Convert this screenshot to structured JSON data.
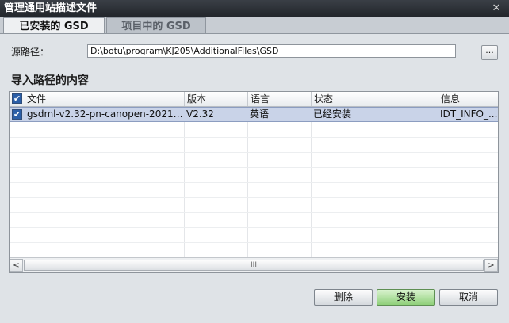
{
  "window": {
    "title": "管理通用站描述文件",
    "close_glyph": "✕"
  },
  "tabs": [
    {
      "label": "已安装的 GSD",
      "active": true
    },
    {
      "label": "项目中的 GSD",
      "active": false
    }
  ],
  "source_path": {
    "label": "源路径：",
    "value": "D:\\botu\\program\\KJ205\\AdditionalFiles\\GSD",
    "browse_label": "..."
  },
  "content_section": {
    "title": "导入路径的内容"
  },
  "table": {
    "header_checked": true,
    "columns": [
      "文件",
      "版本",
      "语言",
      "状态",
      "信息"
    ],
    "rows": [
      {
        "checked": true,
        "file": "gsdml-v2.32-pn-canopen-202111...",
        "version": "V2.32",
        "language": "英语",
        "status": "已经安装",
        "info": "IDT_INFO_..."
      }
    ]
  },
  "scrollbar": {
    "left_arrow": "<",
    "right_arrow": ">",
    "thumb_grip": "III"
  },
  "buttons": {
    "delete": "删除",
    "install": "安装",
    "cancel": "取消"
  },
  "colors": {
    "selection": "#c9d3e8",
    "install_button": "#8fd07a",
    "title_bar": "#2b2f35"
  }
}
